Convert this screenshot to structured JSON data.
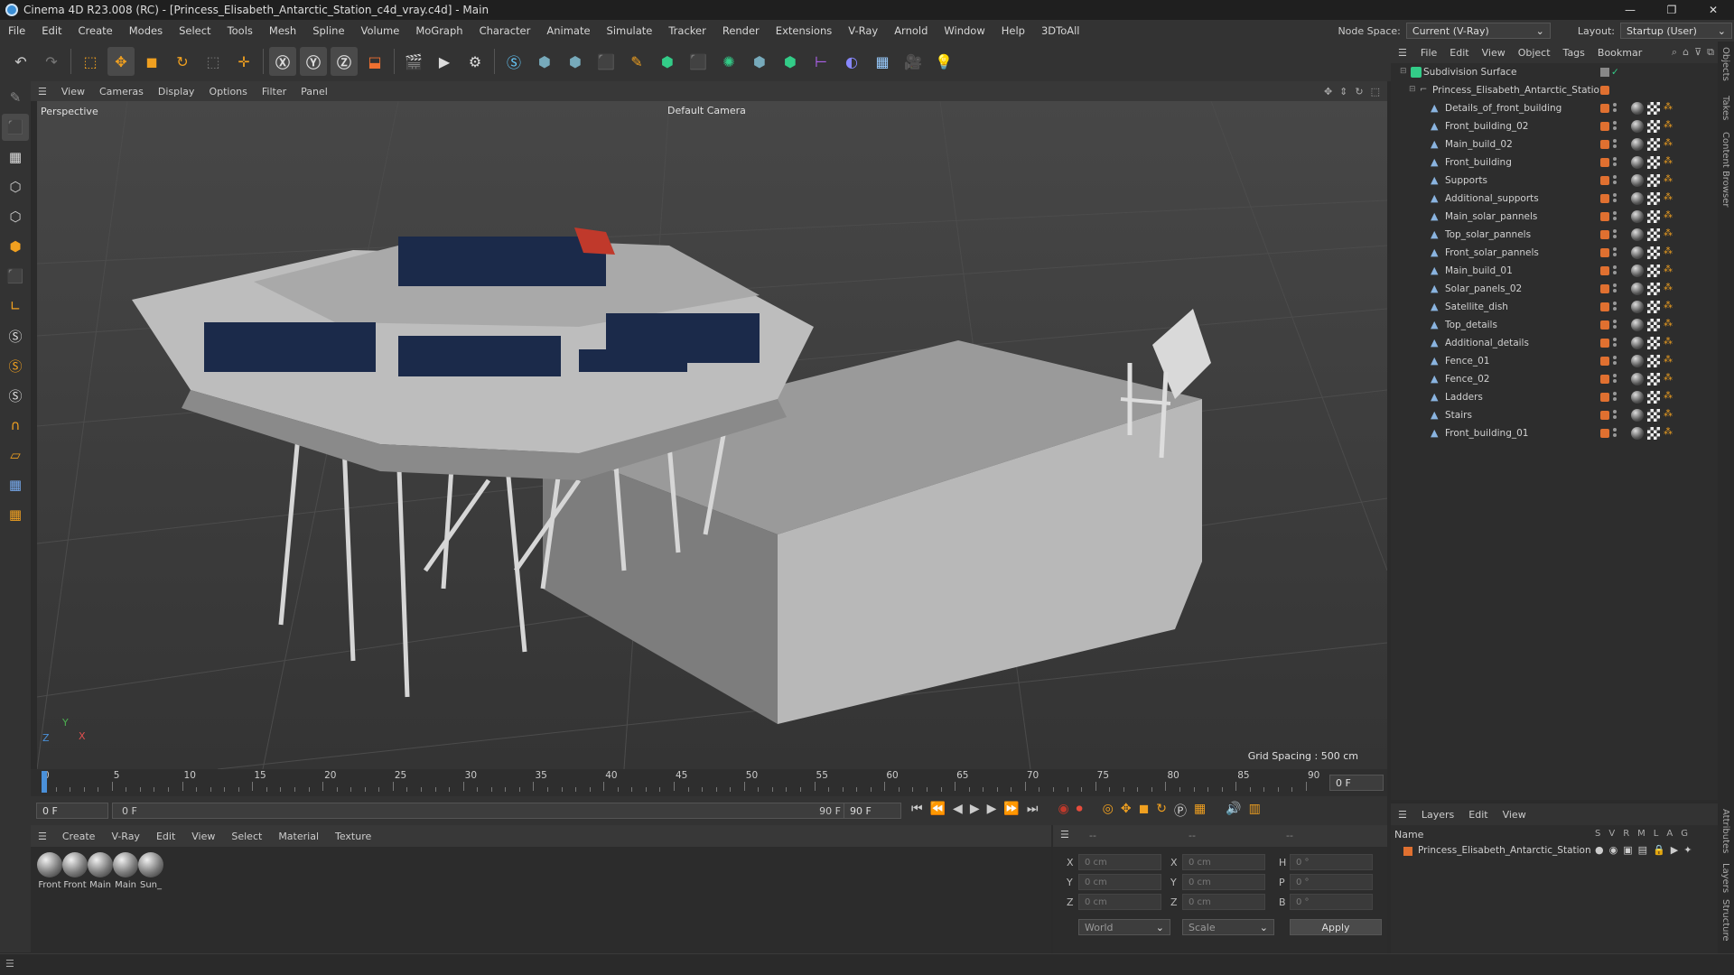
{
  "window": {
    "title": "Cinema 4D R23.008 (RC) - [Princess_Elisabeth_Antarctic_Station_c4d_vray.c4d] - Main"
  },
  "menubar": {
    "items": [
      "File",
      "Edit",
      "Create",
      "Modes",
      "Select",
      "Tools",
      "Mesh",
      "Spline",
      "Volume",
      "MoGraph",
      "Character",
      "Animate",
      "Simulate",
      "Tracker",
      "Render",
      "Extensions",
      "V-Ray",
      "Arnold",
      "Window",
      "Help",
      "3DToAll"
    ],
    "node_space_label": "Node Space:",
    "node_space_value": "Current (V-Ray)",
    "layout_label": "Layout:",
    "layout_value": "Startup (User)"
  },
  "viewport": {
    "menu": [
      "View",
      "Cameras",
      "Display",
      "Options",
      "Filter",
      "Panel"
    ],
    "view_name": "Perspective",
    "camera": "Default Camera",
    "grid_spacing": "Grid Spacing : 500 cm",
    "axis_y": "Y",
    "axis_z": "Z",
    "axis_x": "X"
  },
  "timeline": {
    "ticks": [
      "0",
      "5",
      "10",
      "15",
      "20",
      "25",
      "30",
      "35",
      "40",
      "45",
      "50",
      "55",
      "60",
      "65",
      "70",
      "75",
      "80",
      "85",
      "90"
    ],
    "current_frame_right": "0 F"
  },
  "transport": {
    "start_frame": "0 F",
    "range_start": "0 F",
    "range_end": "90 F",
    "end_frame": "90 F"
  },
  "materials": {
    "menu": [
      "Create",
      "V-Ray",
      "Edit",
      "View",
      "Select",
      "Material",
      "Texture"
    ],
    "items": [
      "Front",
      "Front",
      "Main",
      "Main",
      "Sun_"
    ]
  },
  "coords": {
    "header_a": "--",
    "header_b": "--",
    "header_c": "--",
    "x_label": "X",
    "y_label": "Y",
    "z_label": "Z",
    "h_label": "H",
    "p_label": "P",
    "b_label": "B",
    "x_pos": "0 cm",
    "y_pos": "0 cm",
    "z_pos": "0 cm",
    "x_size": "0 cm",
    "y_size": "0 cm",
    "z_size": "0 cm",
    "h_rot": "0 °",
    "p_rot": "0 °",
    "b_rot": "0 °",
    "space": "World",
    "mode": "Scale",
    "apply": "Apply"
  },
  "objects": {
    "menu": [
      "File",
      "Edit",
      "View",
      "Object",
      "Tags",
      "Bookmar"
    ],
    "root": "Subdivision Surface",
    "group": "Princess_Elisabeth_Antarctic_Station",
    "children": [
      "Details_of_front_building",
      "Front_building_02",
      "Main_build_02",
      "Front_building",
      "Supports",
      "Additional_supports",
      "Main_solar_pannels",
      "Top_solar_pannels",
      "Front_solar_pannels",
      "Main_build_01",
      "Solar_panels_02",
      "Satellite_dish",
      "Top_details",
      "Additional_details",
      "Fence_01",
      "Fence_02",
      "Ladders",
      "Stairs",
      "Front_building_01"
    ]
  },
  "layers": {
    "menu": [
      "Layers",
      "Edit",
      "View"
    ],
    "name_header": "Name",
    "cols": [
      "S",
      "V",
      "R",
      "M",
      "L",
      "A",
      "G"
    ],
    "item": "Princess_Elisabeth_Antarctic_Station"
  },
  "side_tabs": [
    "Objects",
    "Takes",
    "Content Browser",
    "Attributes",
    "Layers",
    "Structure"
  ],
  "colors": {
    "accent_orange": "#e07030",
    "accent_blue": "#3b8fd6",
    "playhead": "#4a90d9"
  }
}
